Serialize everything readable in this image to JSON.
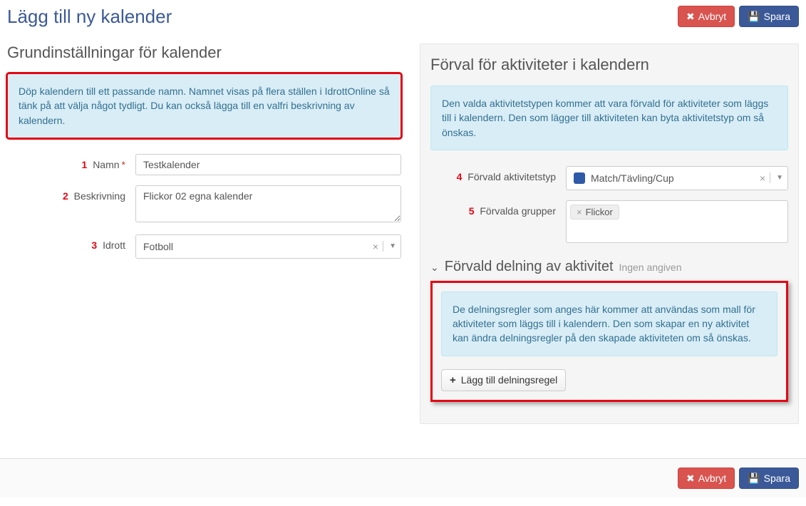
{
  "page_title": "Lägg till ny kalender",
  "buttons": {
    "cancel": "Avbryt",
    "save": "Spara",
    "add_rule": "Lägg till delningsregel"
  },
  "left": {
    "section_title": "Grundinställningar för kalender",
    "info": "Döp kalendern till ett passande namn. Namnet visas på flera ställen i IdrottOnline så tänk på att välja något tydligt. Du kan också lägga till en valfri beskrivning av kalendern.",
    "fields": {
      "name": {
        "num": "1",
        "label": "Namn",
        "value": "Testkalender"
      },
      "desc": {
        "num": "2",
        "label": "Beskrivning",
        "value": "Flickor 02 egna kalender"
      },
      "sport": {
        "num": "3",
        "label": "Idrott",
        "value": "Fotboll"
      }
    }
  },
  "right": {
    "section_title": "Förval för aktiviteter i kalendern",
    "info": "Den valda aktivitetstypen kommer att vara förvald för aktiviteter som läggs till i kalendern. Den som lägger till aktiviteten kan byta aktivitetstyp om så önskas.",
    "fields": {
      "type": {
        "num": "4",
        "label": "Förvald aktivitetstyp",
        "value": "Match/Tävling/Cup",
        "swatch": "#2f5aa8"
      },
      "groups": {
        "num": "5",
        "label": "Förvalda grupper",
        "tag": "Flickor"
      }
    },
    "share": {
      "title": "Förvald delning av aktivitet",
      "status": "Ingen angiven",
      "info": "De delningsregler som anges här kommer att användas som mall för aktiviteter som läggs till i kalendern. Den som skapar en ny aktivitet kan ändra delningsregler på den skapade aktiviteten om så önskas."
    }
  }
}
